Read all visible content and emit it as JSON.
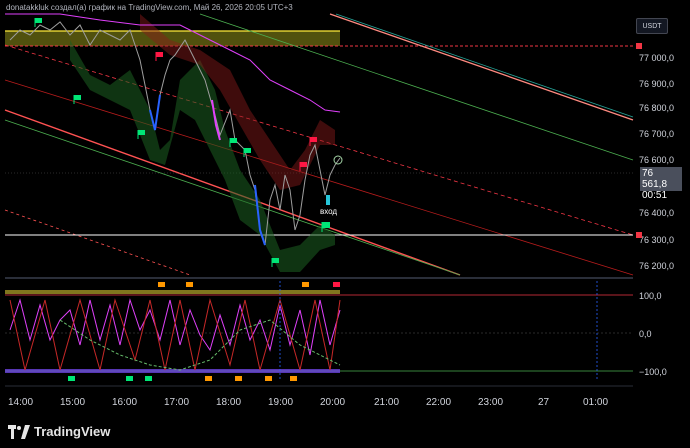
{
  "header": {
    "title": "donatakkluk создал(а) график на TradingView.com, Май 26, 2026 20:05 UTC+3"
  },
  "toolbar": {
    "currency": "USDT"
  },
  "price_axis": {
    "ticks": [
      "77 000,0",
      "76 900,0",
      "76 800,0",
      "76 700,0",
      "76 600,0",
      "76 400,0",
      "76 300,0",
      "76 200,0"
    ]
  },
  "last_price": {
    "value": "76 561,8",
    "countdown": "00:51"
  },
  "oscillator_axis": {
    "ticks": [
      "100,0",
      "0,0",
      "−100,0"
    ]
  },
  "time_axis": {
    "ticks": [
      "14:00",
      "15:00",
      "16:00",
      "17:00",
      "18:00",
      "19:00",
      "20:00",
      "21:00",
      "22:00",
      "23:00",
      "27",
      "01:00"
    ]
  },
  "annotation": {
    "entry_label": "вход"
  },
  "footer": {
    "brand": "TradingView"
  },
  "colors": {
    "background": "#000000",
    "red_line": "#f23645",
    "green_line": "#26a69a",
    "yellow_band": "#ffeb3b",
    "magenta": "#e040fb"
  }
}
